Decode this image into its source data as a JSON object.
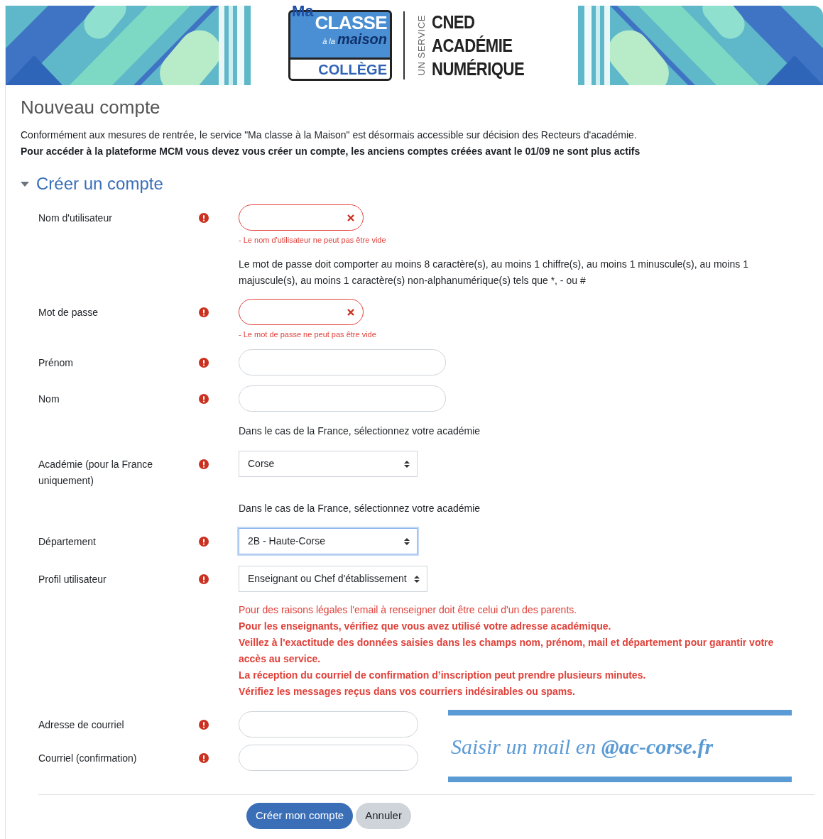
{
  "header": {
    "logo": {
      "ma": "Ma",
      "classe": "CLASSE",
      "a_la": "à la",
      "maison": "maison",
      "college": "COLLÈGE"
    },
    "service": "UN SERVICE",
    "org_lines": [
      "CNED",
      "ACADÉMIE",
      "NUMÉRIQUE"
    ]
  },
  "page_title": "Nouveau compte",
  "intro": [
    {
      "text": "Conformément aux mesures de rentrée, le service \"Ma classe à la Maison\" est désormais accessible sur décision des Recteurs d'académie.",
      "bold": false
    },
    {
      "text": "Pour accéder à la plateforme MCM vous devez vous créer un compte, les anciens comptes créées avant le 01/09 ne sont plus actifs",
      "bold": true
    }
  ],
  "section": {
    "title": "Créer un compte",
    "expanded": true
  },
  "fields": [
    {
      "kind": "text",
      "label": "Nom d'utilisateur",
      "required": true,
      "invalid": true,
      "error": "- Le nom d'utilisateur ne peut pas être vide",
      "wide": false
    },
    {
      "kind": "note",
      "text": "Le mot de passe doit comporter au moins 8 caractère(s), au moins 1 chiffre(s), au moins 1 minuscule(s), au moins 1 majuscule(s), au moins 1 caractère(s) non-alphanumérique(s) tels que *, - ou #"
    },
    {
      "kind": "text",
      "label": "Mot de passe",
      "required": true,
      "invalid": true,
      "error": "- Le mot de passe ne peut pas être vide",
      "wide": false
    },
    {
      "kind": "text",
      "label": "Prénom",
      "required": true,
      "invalid": false,
      "wide": true
    },
    {
      "kind": "text",
      "label": "Nom",
      "required": true,
      "invalid": false,
      "wide": true
    },
    {
      "kind": "note",
      "text": "Dans le cas de la France, sélectionnez votre académie"
    },
    {
      "kind": "select",
      "label": "Académie (pour la France uniquement)",
      "required": true,
      "value": "Corse",
      "focused": false
    },
    {
      "kind": "note",
      "text": "Dans le cas de la France, sélectionnez votre académie"
    },
    {
      "kind": "select",
      "label": "Département",
      "required": true,
      "value": "2B - Haute-Corse",
      "focused": true
    },
    {
      "kind": "select",
      "label": "Profil utilisateur",
      "required": true,
      "value": "Enseignant ou Chef d'établissement",
      "focused": false
    },
    {
      "kind": "notice",
      "lines": [
        {
          "text": "Pour des raisons légales l'email à renseigner doit être celui d'un des parents.",
          "bold": false
        },
        {
          "text": "Pour les enseignants, vérifiez que vous avez utilisé votre adresse académique.",
          "bold": true
        },
        {
          "text": "Veillez à l'exactitude des données saisies dans les champs nom, prénom, mail et département pour garantir votre accès au service.",
          "bold": true
        },
        {
          "text": "La réception du courriel de confirmation d’inscription peut prendre plusieurs minutes.",
          "bold": true
        },
        {
          "text": "Vérifiez les messages reçus dans vos courriers indésirables ou spams.",
          "bold": true
        }
      ]
    }
  ],
  "email_fields": [
    {
      "label": "Adresse de courriel",
      "required": true
    },
    {
      "label": "Courriel (confirmation)",
      "required": true
    }
  ],
  "email_hint": "Saisir un mail en **@ac-corse.fr**",
  "buttons": [
    {
      "label": "Créer mon compte",
      "primary": true
    },
    {
      "label": "Annuler",
      "primary": false
    }
  ]
}
